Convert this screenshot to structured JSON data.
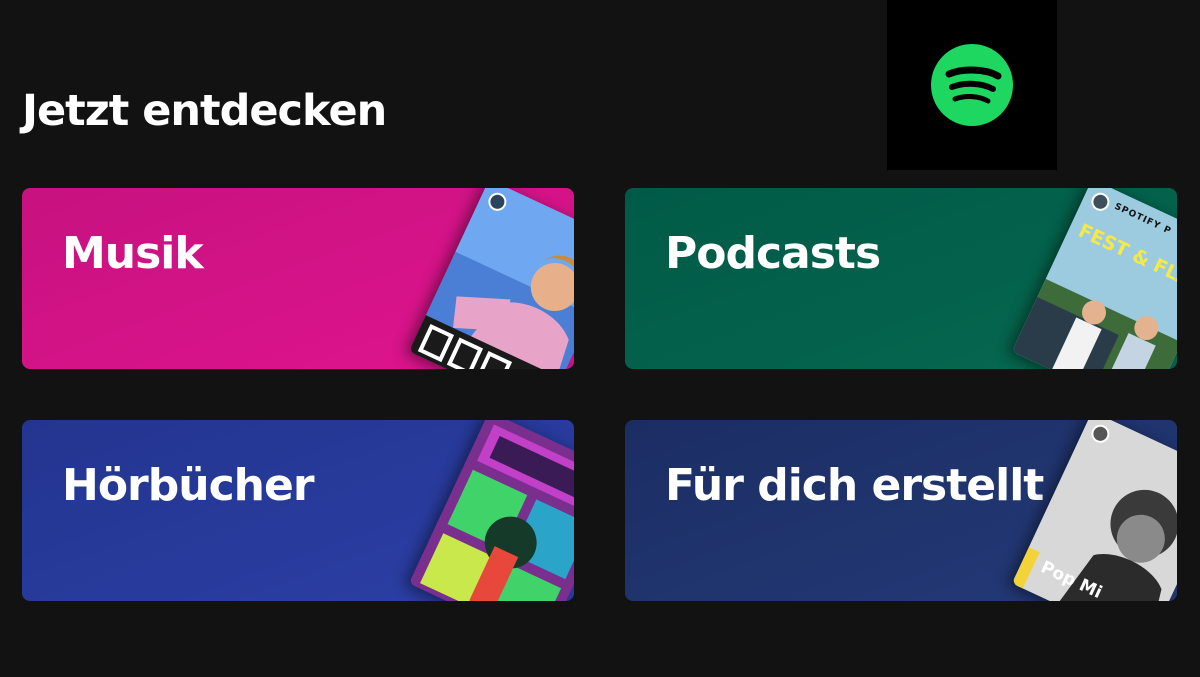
{
  "section": {
    "title": "Jetzt entdecken"
  },
  "logo": {
    "icon": "spotify-logo-icon",
    "color": "#1ed760"
  },
  "cards": [
    {
      "label": "Musik",
      "color": "#d4118b",
      "art": "music-cover-art"
    },
    {
      "label": "Podcasts",
      "color": "#006450",
      "art": "podcast-cover-art",
      "art_text": [
        "SPOTIFY P",
        "FEST & FLAU"
      ]
    },
    {
      "label": "Hörbücher",
      "color": "#27399c",
      "art": "audiobook-cover-art"
    },
    {
      "label": "Für dich erstellt",
      "color": "#1e3264",
      "art": "playlist-cover-art",
      "art_text": [
        "Pop Mi"
      ]
    }
  ]
}
